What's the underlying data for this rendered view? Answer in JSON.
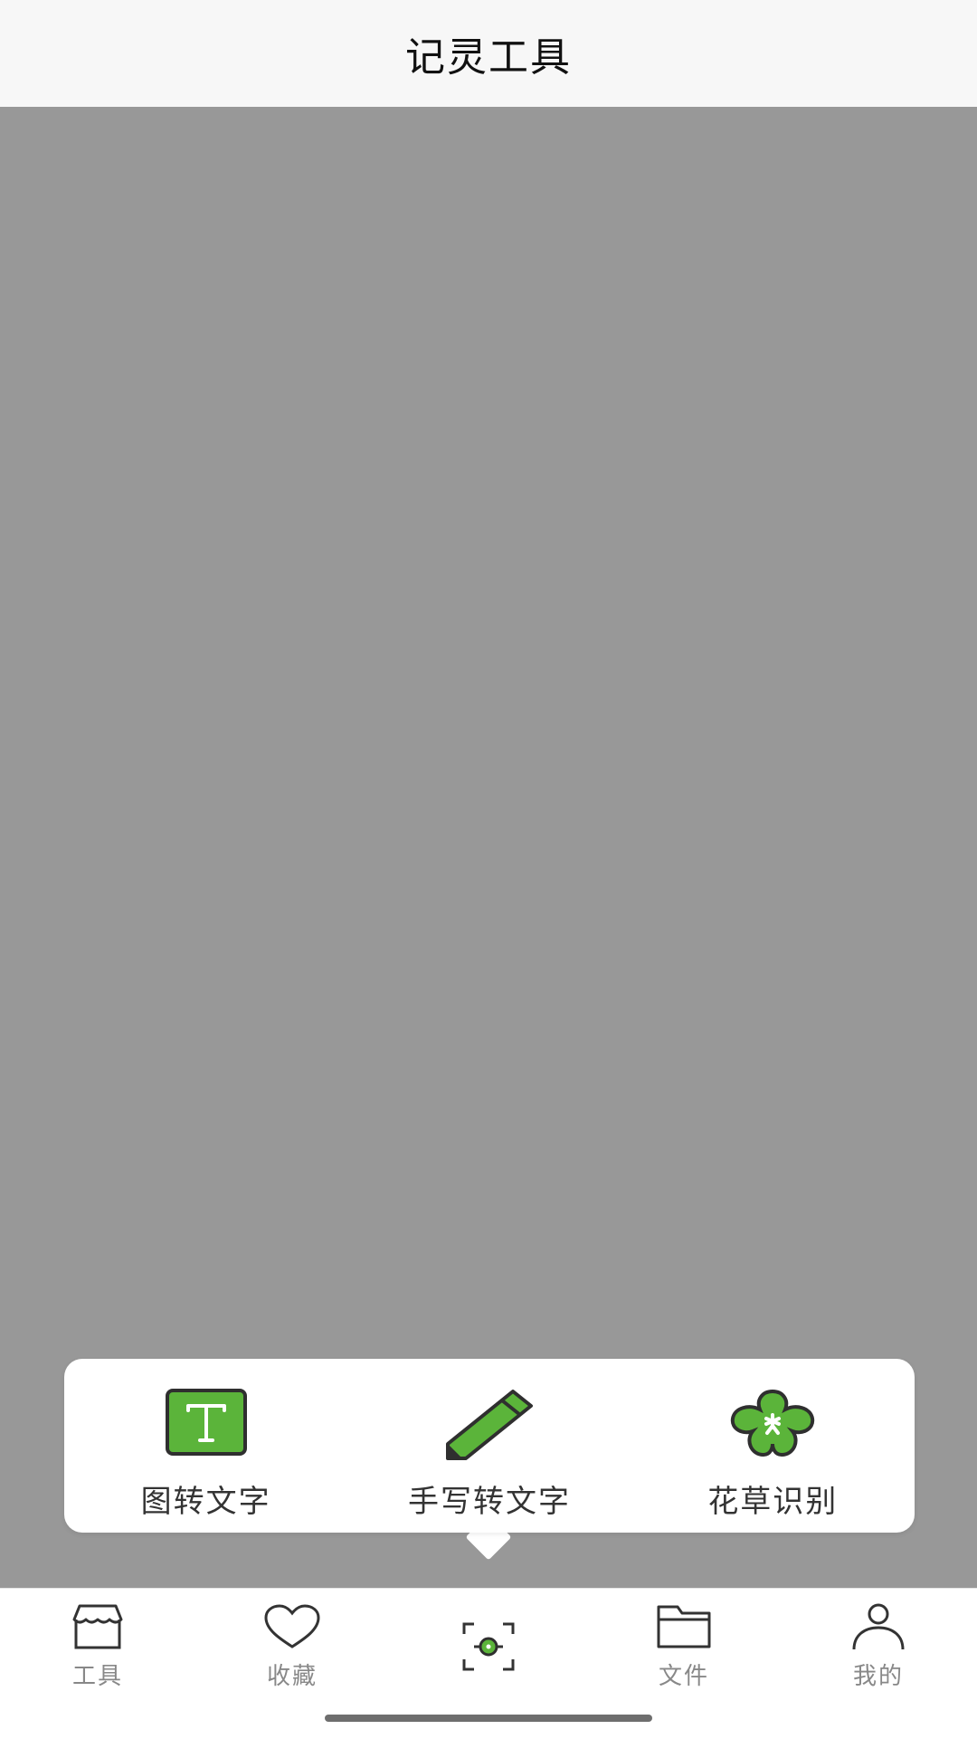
{
  "header": {
    "title": "记灵工具"
  },
  "popup": {
    "items": [
      {
        "label": "图转文字",
        "icon": "text-box-icon"
      },
      {
        "label": "手写转文字",
        "icon": "pencil-icon"
      },
      {
        "label": "花草识别",
        "icon": "flower-icon"
      }
    ]
  },
  "tabbar": {
    "items": [
      {
        "label": "工具",
        "icon": "store-icon"
      },
      {
        "label": "收藏",
        "icon": "heart-icon"
      },
      {
        "label": "",
        "icon": "scan-icon"
      },
      {
        "label": "文件",
        "icon": "folder-icon"
      },
      {
        "label": "我的",
        "icon": "person-icon"
      }
    ]
  },
  "colors": {
    "accent_green": "#5bb43a",
    "overlay_gray": "#989898",
    "tab_text": "#888888"
  }
}
